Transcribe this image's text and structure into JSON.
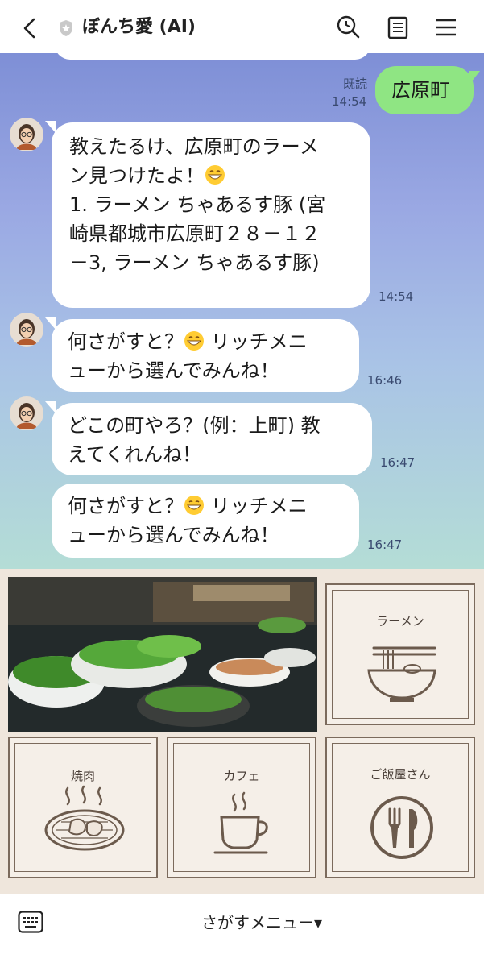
{
  "header": {
    "title": "ぼんち愛 (AI)"
  },
  "chat": {
    "messages": [
      {
        "sender": "user",
        "text": "広原町",
        "status": "既読",
        "time": "14:54"
      },
      {
        "sender": "bot",
        "lines": [
          "教えたるけ、広原町のラーメ",
          "ン見つけたよ！",
          "1. ラーメン ちゃあるす豚 (宮",
          "崎県都城市広原町２８－１２",
          "－3, ラーメン ちゃあるす豚)"
        ],
        "time": "14:54"
      },
      {
        "sender": "bot",
        "lines": [
          "何さがすと？",
          "ューから選んでみんね！"
        ],
        "line1_suffix": " リッチメニ",
        "time": "16:46"
      },
      {
        "sender": "bot",
        "lines": [
          "どこの町やろ？(例：上町) 教",
          "えてくれんね！"
        ],
        "time": "16:47"
      },
      {
        "sender": "bot",
        "lines": [
          "何さがすと？",
          "ューから選んでみんね！"
        ],
        "line1_suffix": " リッチメニ",
        "time": "16:47"
      }
    ]
  },
  "rich_menu": {
    "items": [
      {
        "label": "ラーメン"
      },
      {
        "label": "焼肉"
      },
      {
        "label": "カフェ"
      },
      {
        "label": "ご飯屋さん"
      }
    ]
  },
  "footer": {
    "menu_label": "さがすメニュー▾"
  },
  "icons": {
    "back": "chevron-left-icon",
    "shield": "shield-icon",
    "search": "search-icon",
    "notes": "notes-icon",
    "menu": "hamburger-menu-icon",
    "keyboard": "keyboard-icon"
  },
  "colors": {
    "user_bubble": "#8fe583",
    "bot_bubble": "#ffffff",
    "rich_menu_bg": "#efe6dc",
    "rich_menu_line": "#7b6a5c"
  }
}
